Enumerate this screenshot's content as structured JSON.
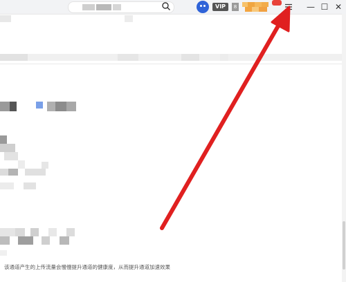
{
  "titlebar": {
    "vip_label": "VIP",
    "level_label": "8"
  },
  "colors": {
    "accent_red": "#e02020",
    "avatar_blue": "#2f63d8",
    "badge_gold": "#f5a623"
  },
  "icons": {
    "search": "search-icon",
    "menu": "menu-icon",
    "minimize": "minimize-icon",
    "maximize": "maximize-icon",
    "close": "close-icon"
  },
  "window_buttons": {
    "minimize": "—",
    "maximize": "☐",
    "close": "✕"
  },
  "description": "该通道产生的上传流量会慢慢提升通道的健康度，从而提升通道加速效果"
}
